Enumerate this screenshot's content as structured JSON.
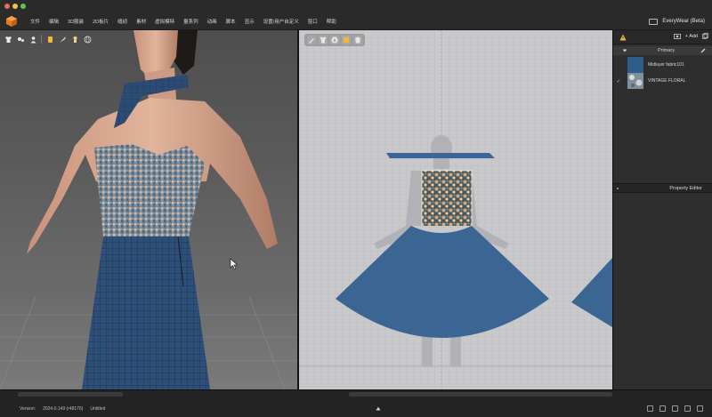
{
  "window": {
    "app_title": "EveryWear (Beta)"
  },
  "menu": {
    "items": [
      "文件",
      "编辑",
      "3D服装",
      "2D板片",
      "缝纫",
      "素材",
      "虚拟模特",
      "量系列",
      "动画",
      "脚本",
      "显示",
      "设置/用户自定义",
      "窗口",
      "帮助"
    ]
  },
  "fabric_panel": {
    "add_label": "+ Add",
    "group_label": "Primary",
    "items": [
      {
        "name": "Midlayer fabric101",
        "checked": false,
        "color": "#2f5d8a"
      },
      {
        "name": "VINTAGE FLORAL",
        "checked": true,
        "color": "#8e8e92"
      }
    ],
    "check_mark": "✓"
  },
  "property_editor": {
    "label": "Property Editor"
  },
  "status": {
    "version_label": "Version:",
    "version": "2024.0.149 (r48176)",
    "file": "Untitled"
  },
  "colors": {
    "accent": "#f0b93a",
    "skirt_blue": "#3b6693",
    "viewport_2d_bg": "#c9c9cc",
    "panel_bg": "#2e2e2e"
  },
  "icons": {
    "toolbar_3d": [
      "shirt-icon",
      "hanger-icon",
      "avatar-icon",
      "texture-icon",
      "brush-icon",
      "mannequin-icon",
      "sphere-icon"
    ],
    "toolbar_2d": [
      "pen-icon",
      "shirt-icon",
      "info-icon",
      "pattern-icon",
      "garment-icon"
    ],
    "statusbar": [
      "panel-left-icon",
      "panel-bottom-icon",
      "panel-split-icon",
      "panel-right-icon",
      "panel-full-icon"
    ]
  }
}
